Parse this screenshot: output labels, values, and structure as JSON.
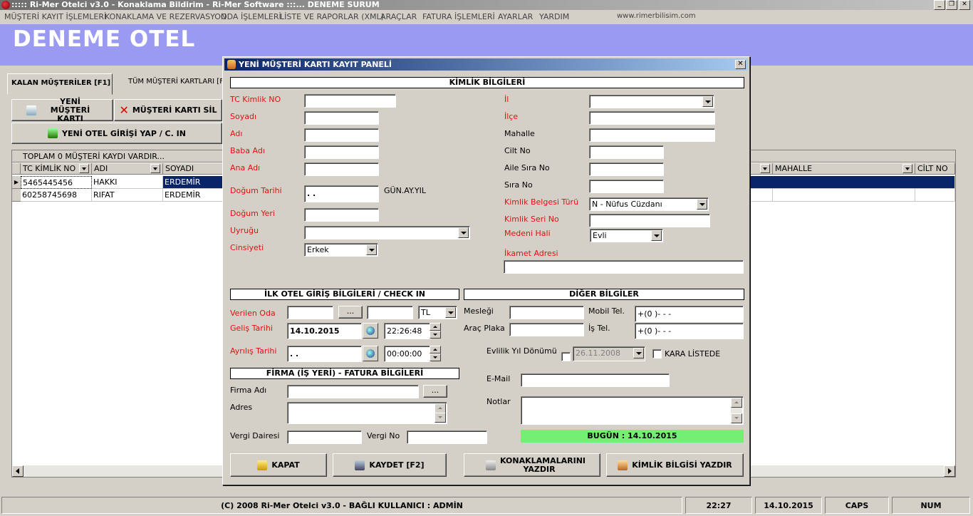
{
  "window": {
    "title": "::::: Ri-Mer Otelci v3.0 - Konaklama Bildirim - Ri-Mer Software :::... DENEME SURUM",
    "minimize": "_",
    "restore": "❐",
    "close": "✕"
  },
  "menu": [
    "MÜŞTERİ KAYIT İŞLEMLERİ",
    "KONAKLAMA VE REZERVASYON",
    "ODA İŞLEMLERİ",
    "LİSTE VE RAPORLAR (XML)",
    "ARAÇLAR",
    "FATURA İŞLEMLERİ",
    "AYARLAR",
    "YARDIM"
  ],
  "website": "www.rimerbilisim.com",
  "hotel_name": "DENEME OTEL",
  "tabs": {
    "active": "KALAN MÜŞTERİLER [F1]",
    "other": "TÜM MÜŞTERİ KARTLARI [F"
  },
  "toolbar": {
    "new_customer": "YENİ MÜŞTERİ KARTI",
    "delete_customer": "MÜŞTERİ KARTI SİL",
    "new_checkin": "YENİ OTEL GİRİŞİ YAP / C. IN"
  },
  "grid": {
    "summary": "TOPLAM 0 MÜŞTERİ KAYDI VARDIR...",
    "columns": [
      "TC KİMLİK NO",
      "ADI",
      "SOYADI",
      "MAHALLE",
      "CİLT NO"
    ],
    "rows": [
      {
        "tc": "5465445456",
        "adi": "HAKKI",
        "soyadi": "ERDEMİR"
      },
      {
        "tc": "60258745698",
        "adi": "RIFAT",
        "soyadi": "ERDEMİR"
      }
    ],
    "row_marker": "▶"
  },
  "status": {
    "copyright": "(C) 2008 Ri-Mer Otelci v3.0 - BAĞLI KULLANICI : ADMİN",
    "time": "22:27",
    "date": "14.10.2015",
    "caps": "CAPS",
    "num": "NUM"
  },
  "dialog": {
    "title": "YENİ MÜŞTERİ KARTI KAYIT PANELİ",
    "close": "✕",
    "sections": {
      "identity": "KİMLİK BİLGİLERİ",
      "checkin": "İLK OTEL GİRİŞ BİLGİLERİ / CHECK IN",
      "other": "DİĞER BİLGİLER",
      "company": "FİRMA (İŞ YERİ) - FATURA BİLGİLERİ"
    },
    "labels": {
      "tc": "TC Kimlik NO",
      "soyadi": "Soyadı",
      "adi": "Adı",
      "baba": "Baba Adı",
      "ana": "Ana Adı",
      "dogum_tarihi": "Doğum Tarihi",
      "date_format": "GÜN.AY.YIL",
      "dogum_yeri": "Doğum Yeri",
      "uyruk": "Uyruğu",
      "cinsiyet": "Cinsiyeti",
      "il": "İl",
      "ilce": "İlçe",
      "mahalle": "Mahalle",
      "cilt": "Cilt No",
      "aile_sira": "Aile Sıra No",
      "sira": "Sıra No",
      "belge_turu": "Kimlik Belgesi Türü",
      "seri": "Kimlik Seri No",
      "medeni": "Medeni Hali",
      "ikamet": "İkamet Adresi",
      "verilen_oda": "Verilen Oda",
      "gelis": "Geliş Tarihi",
      "ayrilis": "Ayrılış Tarihi",
      "meslek": "Mesleği",
      "plaka": "Araç Plaka",
      "mobil": "Mobil Tel.",
      "is_tel": "İş Tel.",
      "evlilik": "Evlilik Yıl Dönümü",
      "kara_liste": "KARA LİSTEDE",
      "firma": "Firma Adı",
      "adres": "Adres",
      "email": "E-Mail",
      "notlar": "Notlar",
      "vergi_dairesi": "Vergi Dairesi",
      "vergi_no": "Vergi No"
    },
    "values": {
      "dogum_tarihi": " . .",
      "cinsiyet": "Erkek",
      "belge_turu": "N - Nüfus Cüzdanı",
      "medeni": "Evli",
      "currency": "TL",
      "gelis_tarihi": "14.10.2015",
      "gelis_saat": "22:26:48",
      "ayrilis_tarihi": " . .",
      "ayrilis_saat": "00:00:00",
      "mobil": "+(0 )-   -   -",
      "is_tel": "+(0 )-   -   -",
      "evlilik": "26.11.2008",
      "ellipsis": "..."
    },
    "today": "BUGÜN : 14.10.2015",
    "buttons": {
      "kapat": "KAPAT",
      "kaydet": "KAYDET [F2]",
      "konaklama": "KONAKLAMALARINI YAZDIR",
      "kimlik": "KİMLİK BİLGİSİ YAZDIR"
    }
  }
}
